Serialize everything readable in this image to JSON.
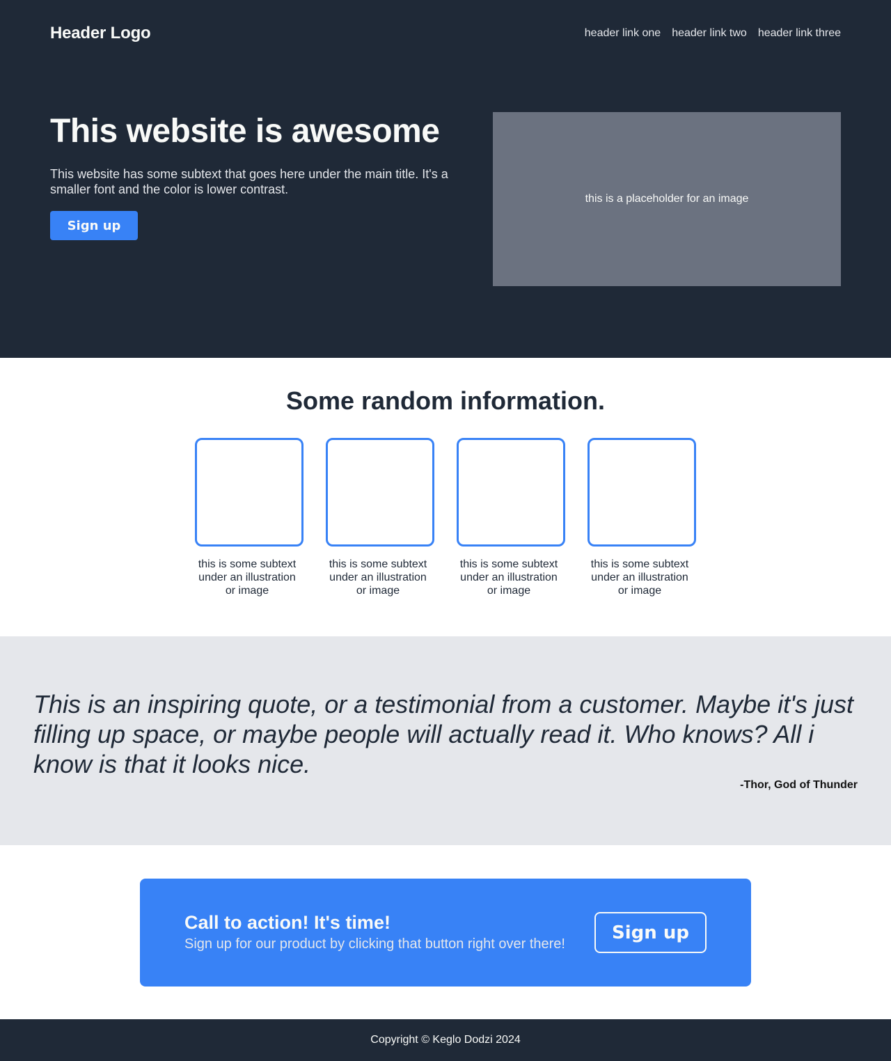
{
  "header": {
    "logo": "Header Logo",
    "links": [
      "header link one",
      "header link two",
      "header link three"
    ]
  },
  "hero": {
    "title": "This website is awesome",
    "subtitle": "This website has some subtext that goes here under the main title. It's a smaller font and the color is lower contrast.",
    "button_label": "Sign up",
    "image_placeholder": "this is a placeholder for an image"
  },
  "info": {
    "title": "Some random information.",
    "cards": [
      {
        "text": "this is some subtext under an illustration or image"
      },
      {
        "text": "this is some subtext under an illustration or image"
      },
      {
        "text": "this is some subtext under an illustration or image"
      },
      {
        "text": "this is some subtext under an illustration or image"
      }
    ]
  },
  "quote": {
    "text": "This is an inspiring quote, or a testimonial from a customer. Maybe it's just filling up space, or maybe people will actually read it. Who knows? All i know is that it looks nice.",
    "author": "-Thor, God of Thunder"
  },
  "cta": {
    "title": "Call to action! It's time!",
    "subtitle": "Sign up for our product by clicking that button right over there!",
    "button_label": "Sign up"
  },
  "footer": {
    "copyright": "Copyright © Keglo Dodzi 2024"
  },
  "colors": {
    "dark": "#1f2937",
    "accent": "#3882f6",
    "light": "#f9faf8",
    "gray": "#e5e7eb",
    "placeholder": "#6b7280"
  }
}
